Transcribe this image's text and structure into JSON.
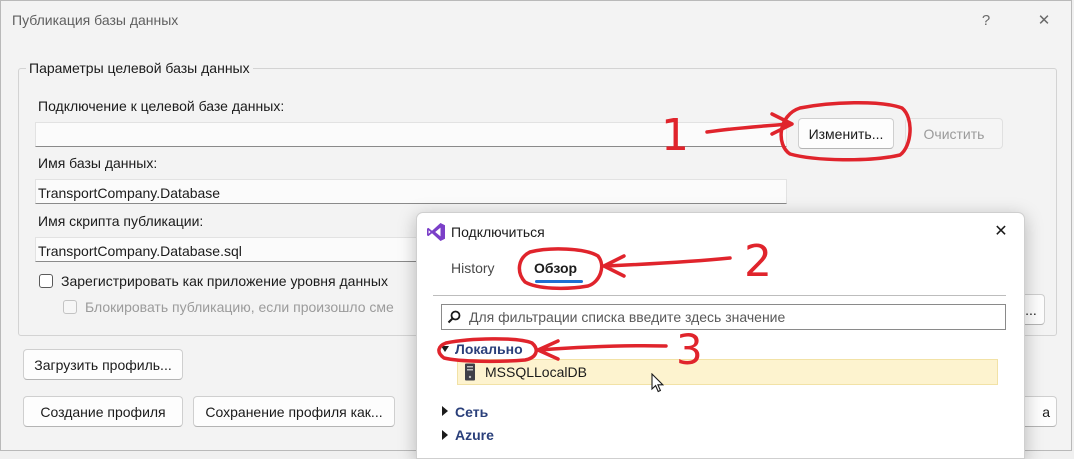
{
  "window": {
    "title": "Публикация базы данных",
    "help_label": "?",
    "close_label": "✕"
  },
  "target_group": {
    "title": "Параметры целевой базы данных",
    "connection_label": "Подключение к целевой базе данных:",
    "connection_value": "",
    "change_button": "Изменить...",
    "clear_button": "Очистить",
    "db_name_label": "Имя базы данных:",
    "db_name_value": "TransportCompany.Database",
    "script_name_label": "Имя скрипта публикации:",
    "script_name_value": "TransportCompany.Database.sql",
    "register_checkbox_label": "Зарегистрировать как приложение уровня данных",
    "block_checkbox_label": "Блокировать публикацию, если произошло сме",
    "advanced_button_partial": "..."
  },
  "footer": {
    "load_profile_button": "Загрузить профиль...",
    "create_profile_button": "Создание профиля",
    "save_profile_button": "Сохранение профиля как...",
    "right_button_partial": "а"
  },
  "connect_dialog": {
    "title": "Подключиться",
    "close_label": "✕",
    "tabs": [
      {
        "label": "History",
        "active": false
      },
      {
        "label": "Обзор",
        "active": true
      }
    ],
    "search_placeholder": "Для фильтрации списка введите здесь значение",
    "tree": {
      "local_label": "Локально",
      "local_items": [
        "MSSQLLocalDB"
      ],
      "network_label": "Сеть",
      "azure_label": "Azure"
    }
  },
  "annotations": {
    "marks": [
      "1",
      "2",
      "3"
    ],
    "color": "#e0242c"
  },
  "colors": {
    "accent": "#1f6fd1",
    "tree_header": "#2a3f7a",
    "selection": "#fdf3cf"
  }
}
